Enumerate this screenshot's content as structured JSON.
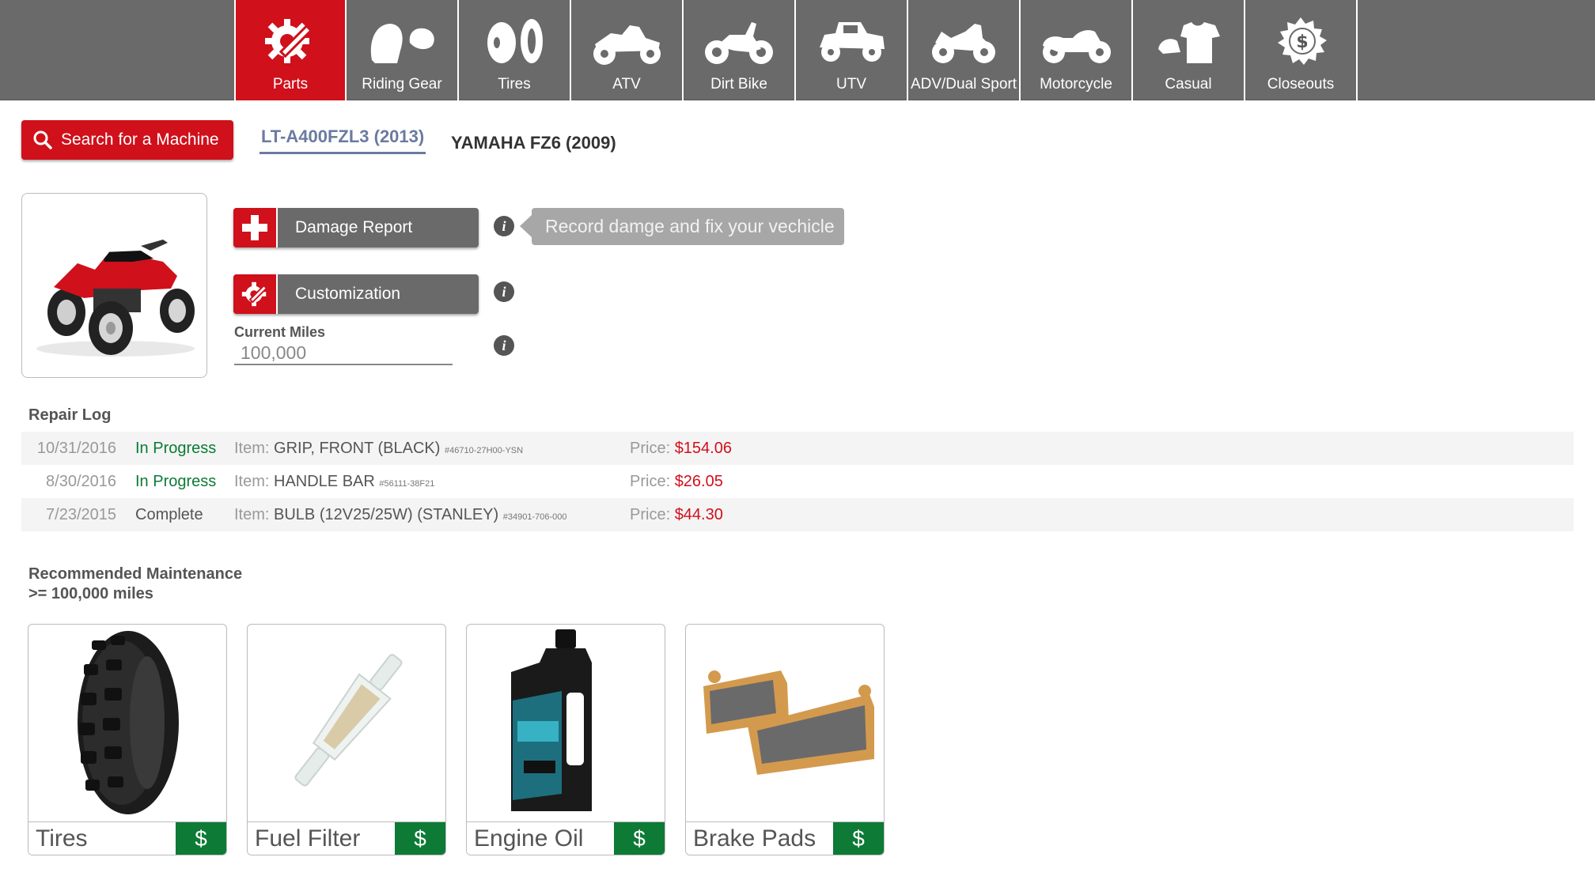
{
  "nav": {
    "items": [
      {
        "label": "Parts",
        "icon": "gear-wrench-icon",
        "active": true
      },
      {
        "label": "Riding Gear",
        "icon": "helmet-icon",
        "active": false
      },
      {
        "label": "Tires",
        "icon": "tire-icon",
        "active": false
      },
      {
        "label": "ATV",
        "icon": "atv-icon",
        "active": false
      },
      {
        "label": "Dirt Bike",
        "icon": "dirt-bike-icon",
        "active": false
      },
      {
        "label": "UTV",
        "icon": "utv-icon",
        "active": false
      },
      {
        "label": "ADV/Dual Sport",
        "icon": "adv-bike-icon",
        "active": false
      },
      {
        "label": "Motorcycle",
        "icon": "motorcycle-icon",
        "active": false
      },
      {
        "label": "Casual",
        "icon": "shirt-cap-icon",
        "active": false
      },
      {
        "label": "Closeouts",
        "icon": "dollar-badge-icon",
        "active": false
      }
    ]
  },
  "machine_bar": {
    "search_label": "Search for a Machine",
    "machines": [
      {
        "label": "LT-A400FZL3 (2013)",
        "active": true
      },
      {
        "label": "YAMAHA FZ6 (2009)",
        "active": false
      }
    ]
  },
  "machine": {
    "damage_label": "Damage Report",
    "customize_label": "Customization",
    "tooltip": "Record damge and fix your vechicle",
    "miles_label": "Current Miles",
    "miles_value": "100,000"
  },
  "repair_log": {
    "title": "Repair Log",
    "item_label": "Item:",
    "price_label": "Price:",
    "rows": [
      {
        "date": "10/31/2016",
        "status": "In Progress",
        "item": "GRIP, FRONT (BLACK)",
        "part": "#46710-27H00-YSN",
        "price": "$154.06"
      },
      {
        "date": "8/30/2016",
        "status": "In Progress",
        "item": "HANDLE BAR",
        "part": "#56111-38F21",
        "price": "$26.05"
      },
      {
        "date": "7/23/2015",
        "status": "Complete",
        "item": "BULB (12V25/25W) (STANLEY)",
        "part": "#34901-706-000",
        "price": "$44.30"
      }
    ]
  },
  "maintenance": {
    "title": "Recommended Maintenance",
    "subtitle": ">= 100,000 miles",
    "buy_label": "$",
    "cards": [
      {
        "name": "Tires"
      },
      {
        "name": "Fuel Filter"
      },
      {
        "name": "Engine Oil"
      },
      {
        "name": "Brake Pads"
      }
    ]
  },
  "colors": {
    "brand_red": "#d0101b",
    "nav_gray": "#6a6a6a",
    "status_green": "#0d7a35",
    "active_tab_blue": "#6b7aa0"
  }
}
